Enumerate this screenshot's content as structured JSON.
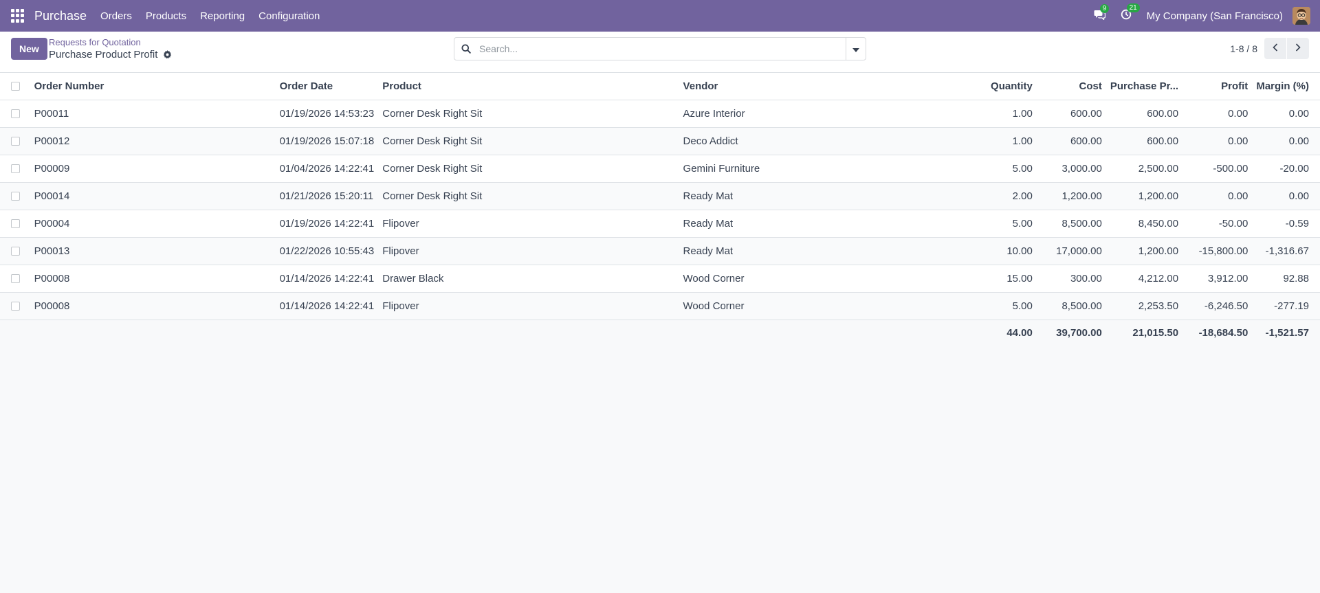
{
  "navbar": {
    "app_name": "Purchase",
    "menu": [
      "Orders",
      "Products",
      "Reporting",
      "Configuration"
    ],
    "messages_badge": "9",
    "activities_badge": "21",
    "company": "My Company (San Francisco)"
  },
  "control_panel": {
    "new_label": "New",
    "breadcrumb_parent": "Requests for Quotation",
    "breadcrumb_current": "Purchase Product Profit",
    "search_placeholder": "Search...",
    "pager_value": "1-8 / 8"
  },
  "table": {
    "columns": [
      "Order Number",
      "Order Date",
      "Product",
      "Vendor",
      "Quantity",
      "Cost",
      "Purchase Pr...",
      "Profit",
      "Margin (%)"
    ],
    "rows": [
      {
        "order": "P00011",
        "date": "01/19/2026 14:53:23",
        "product": "Corner Desk Right Sit",
        "vendor": "Azure Interior",
        "qty": "1.00",
        "cost": "600.00",
        "price": "600.00",
        "profit": "0.00",
        "margin": "0.00"
      },
      {
        "order": "P00012",
        "date": "01/19/2026 15:07:18",
        "product": "Corner Desk Right Sit",
        "vendor": "Deco Addict",
        "qty": "1.00",
        "cost": "600.00",
        "price": "600.00",
        "profit": "0.00",
        "margin": "0.00"
      },
      {
        "order": "P00009",
        "date": "01/04/2026 14:22:41",
        "product": "Corner Desk Right Sit",
        "vendor": "Gemini Furniture",
        "qty": "5.00",
        "cost": "3,000.00",
        "price": "2,500.00",
        "profit": "-500.00",
        "margin": "-20.00"
      },
      {
        "order": "P00014",
        "date": "01/21/2026 15:20:11",
        "product": "Corner Desk Right Sit",
        "vendor": "Ready Mat",
        "qty": "2.00",
        "cost": "1,200.00",
        "price": "1,200.00",
        "profit": "0.00",
        "margin": "0.00"
      },
      {
        "order": "P00004",
        "date": "01/19/2026 14:22:41",
        "product": "Flipover",
        "vendor": "Ready Mat",
        "qty": "5.00",
        "cost": "8,500.00",
        "price": "8,450.00",
        "profit": "-50.00",
        "margin": "-0.59"
      },
      {
        "order": "P00013",
        "date": "01/22/2026 10:55:43",
        "product": "Flipover",
        "vendor": "Ready Mat",
        "qty": "10.00",
        "cost": "17,000.00",
        "price": "1,200.00",
        "profit": "-15,800.00",
        "margin": "-1,316.67"
      },
      {
        "order": "P00008",
        "date": "01/14/2026 14:22:41",
        "product": "Drawer Black",
        "vendor": "Wood Corner",
        "qty": "15.00",
        "cost": "300.00",
        "price": "4,212.00",
        "profit": "3,912.00",
        "margin": "92.88"
      },
      {
        "order": "P00008",
        "date": "01/14/2026 14:22:41",
        "product": "Flipover",
        "vendor": "Wood Corner",
        "qty": "5.00",
        "cost": "8,500.00",
        "price": "2,253.50",
        "profit": "-6,246.50",
        "margin": "-277.19"
      }
    ],
    "totals": {
      "qty": "44.00",
      "cost": "39,700.00",
      "price": "21,015.50",
      "profit": "-18,684.50",
      "margin": "-1,521.57"
    }
  },
  "colors": {
    "brand": "#71639e",
    "badge": "#28a745"
  }
}
